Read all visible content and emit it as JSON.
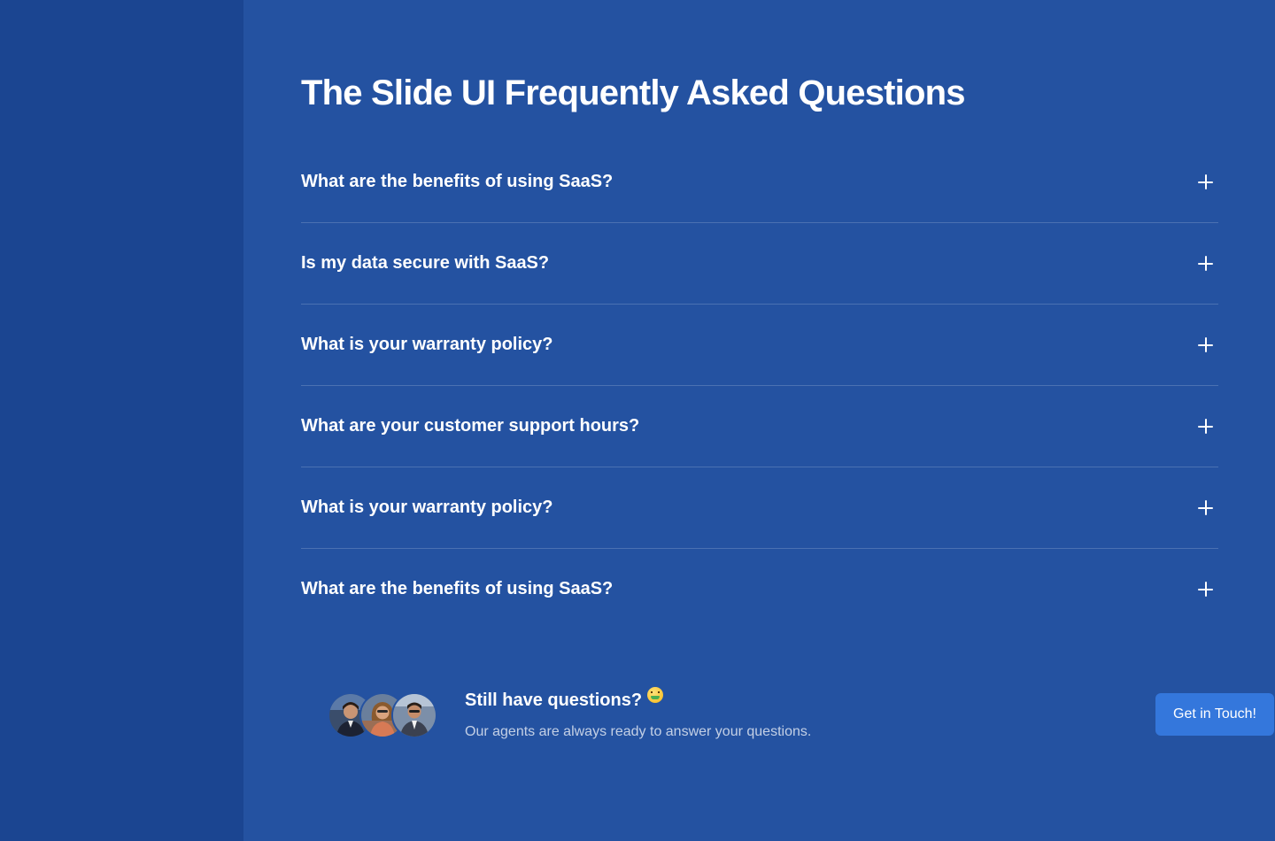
{
  "page": {
    "title": "The Slide UI Frequently Asked Questions"
  },
  "faq": {
    "items": [
      {
        "question": "What are the benefits of using SaaS?"
      },
      {
        "question": "Is my data secure with SaaS?"
      },
      {
        "question": "What is your warranty policy?"
      },
      {
        "question": "What are your customer support hours?"
      },
      {
        "question": "What is your warranty policy?"
      },
      {
        "question": "What are the benefits of using SaaS?"
      }
    ],
    "expand_icon": "plus-icon"
  },
  "cta": {
    "title": "Still have questions?",
    "emoji": "money-mouth-face-emoji",
    "subtitle": "Our agents are always ready to answer your questions.",
    "button_label": "Get in Touch!"
  },
  "colors": {
    "sidebar": "#1b4591",
    "background": "#2452a1",
    "button": "#3477dc",
    "text": "#ffffff"
  }
}
